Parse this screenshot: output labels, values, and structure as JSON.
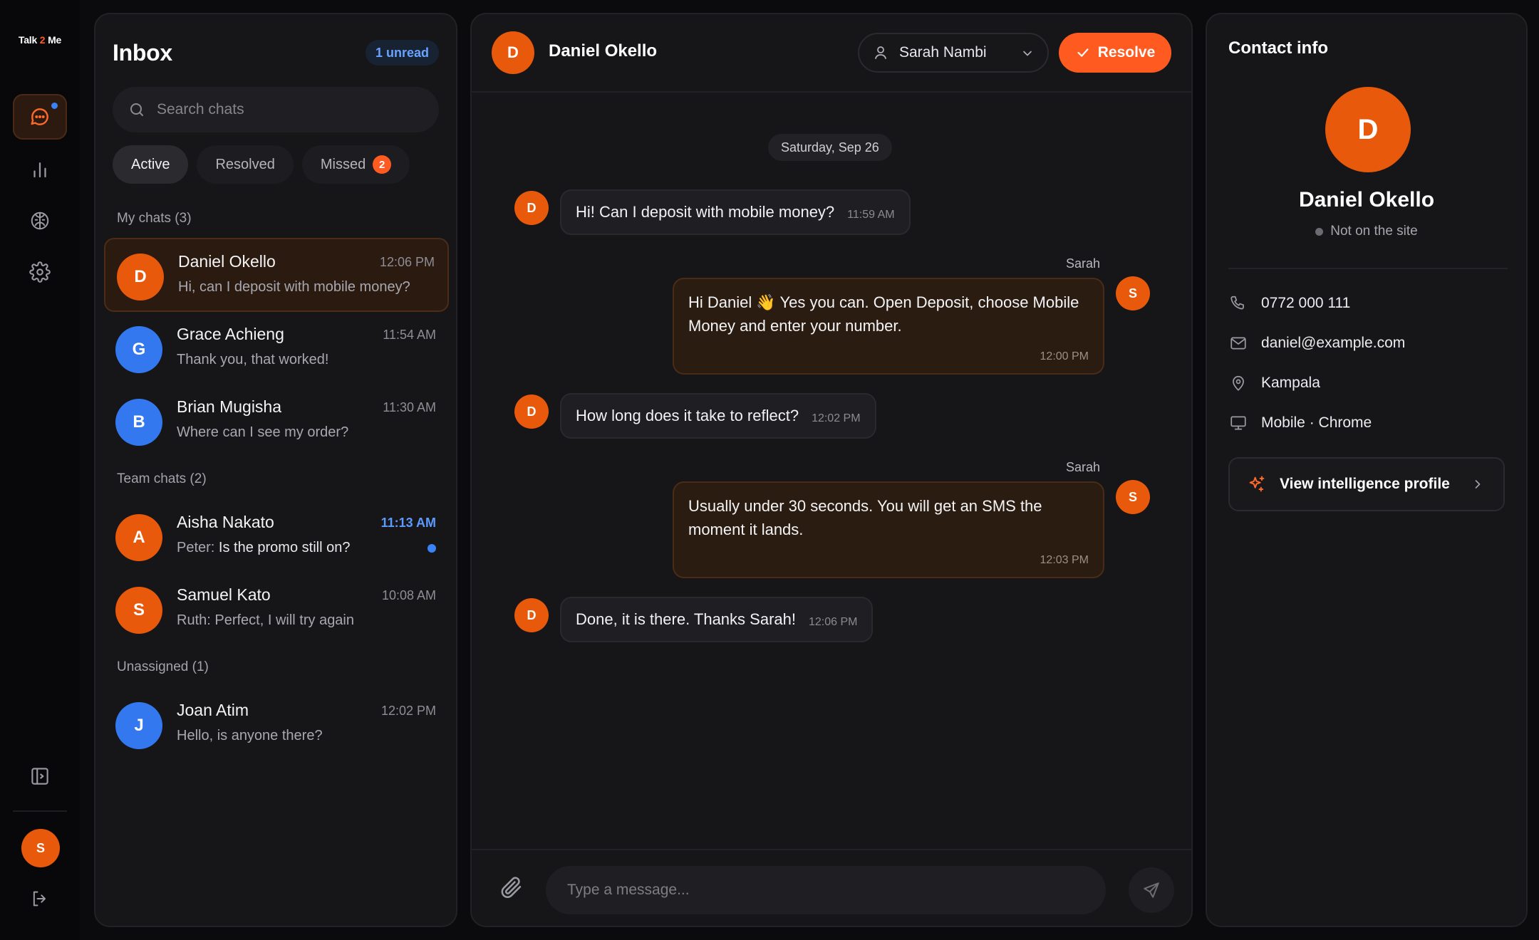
{
  "app": {
    "logo_pre": "Talk",
    "logo_num": "2",
    "logo_post": "Me"
  },
  "rail": {
    "nav": [
      {
        "name": "chats",
        "icon": "chat-bubble-icon",
        "active": true,
        "has_dot": true
      },
      {
        "name": "analytics",
        "icon": "bar-chart-icon"
      },
      {
        "name": "intelligence",
        "icon": "brain-icon"
      },
      {
        "name": "settings",
        "icon": "gear-icon"
      }
    ],
    "bottom": [
      {
        "name": "collapse",
        "icon": "sidebar-toggle-icon"
      },
      {
        "name": "logout",
        "icon": "logout-icon"
      }
    ],
    "user_initial": "S"
  },
  "inbox": {
    "title": "Inbox",
    "unread_label": "1 unread",
    "search_placeholder": "Search chats",
    "filters": [
      {
        "label": "Active",
        "active": true
      },
      {
        "label": "Resolved"
      },
      {
        "label": "Missed",
        "count": "2"
      }
    ],
    "sections": [
      {
        "label": "My chats (3)"
      },
      {
        "label": "Team chats (2)"
      },
      {
        "label": "Unassigned (1)"
      }
    ],
    "conversations": [
      {
        "initial": "D",
        "name": "Daniel Okello",
        "time": "12:06 PM",
        "preview": "Hi, can I deposit with mobile money?",
        "color": "#e8590c",
        "active": true
      },
      {
        "initial": "G",
        "name": "Grace Achieng",
        "time": "11:54 AM",
        "preview": "Thank you, that worked!",
        "color": "#3478f0"
      },
      {
        "initial": "B",
        "name": "Brian Mugisha",
        "time": "11:30 AM",
        "preview": "Where can I see my order?",
        "color": "#3478f0"
      },
      {
        "initial": "A",
        "name": "Aisha Nakato",
        "time": "11:13 AM",
        "preview_prefix": "Peter:",
        "preview": "Is the promo still on?",
        "color": "#e8590c",
        "unread": true
      },
      {
        "initial": "S",
        "name": "Samuel Kato",
        "time": "10:08 AM",
        "preview_prefix": "Ruth:",
        "preview": "Perfect, I will try again",
        "color": "#e8590c"
      },
      {
        "initial": "J",
        "name": "Joan Atim",
        "time": "12:02 PM",
        "preview": "Hello, is anyone there?",
        "color": "#3478f0"
      }
    ]
  },
  "chat": {
    "initial": "D",
    "name": "Daniel Okello",
    "assignee": "Sarah Nambi",
    "resolve_label": "Resolve",
    "date_label": "Saturday, Sep 26",
    "messages": [
      {
        "from": "customer",
        "initial": "D",
        "text": "Hi! Can I deposit with mobile money?",
        "time": "11:59 AM"
      },
      {
        "from": "agent",
        "sender": "Sarah",
        "initial": "S",
        "line1": "Hi Daniel 👋 Yes you can. Open Deposit, choose Mobile",
        "line2": "Money and enter your number.",
        "time": "12:00 PM"
      },
      {
        "from": "customer",
        "initial": "D",
        "text": "How long does it take to reflect?",
        "time": "12:02 PM"
      },
      {
        "from": "agent",
        "sender": "Sarah",
        "initial": "S",
        "line1": "Usually under 30 seconds. You will get an SMS the",
        "line2": "moment it lands.",
        "time": "12:03 PM"
      },
      {
        "from": "customer",
        "initial": "D",
        "text": "Done, it is there. Thanks Sarah!",
        "time": "12:06 PM"
      }
    ],
    "composer_placeholder": "Type a message..."
  },
  "contact": {
    "title": "Contact info",
    "initial": "D",
    "name": "Daniel Okello",
    "presence": "Not on the site",
    "phone": "0772 000 111",
    "email": "daniel@example.com",
    "location": "Kampala",
    "device": "Mobile · Chrome",
    "intel_label": "View intelligence profile"
  },
  "colors": {
    "accent": "#ff5a1f",
    "blue": "#3b82f6",
    "background": "#0b0b0d",
    "panel": "#161618"
  }
}
